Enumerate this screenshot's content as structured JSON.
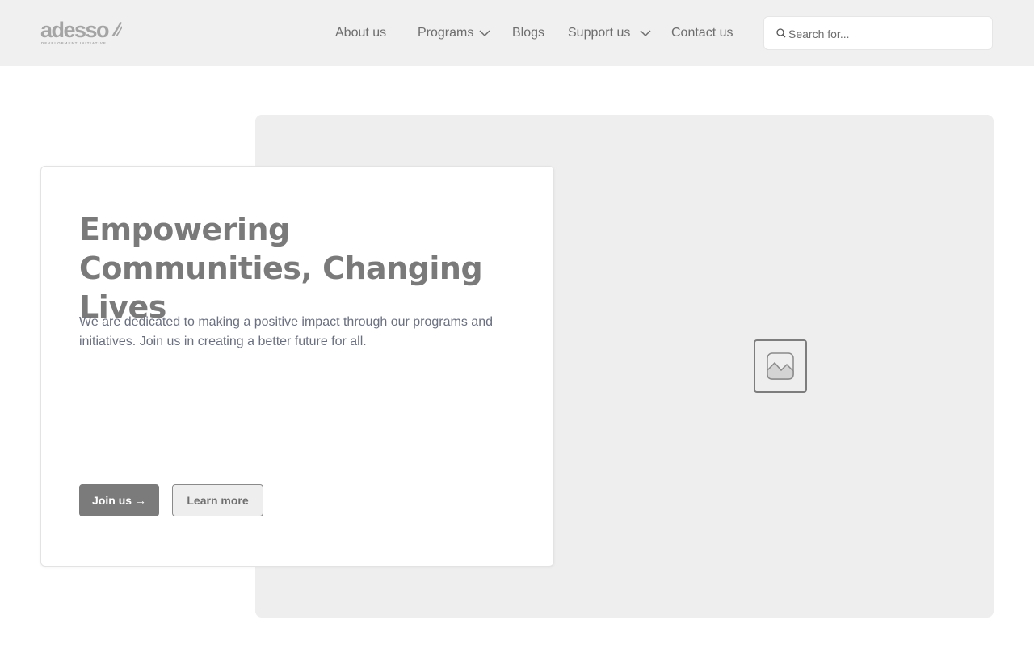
{
  "header": {
    "logo": {
      "word": "adesso",
      "tagline": "DEVELOPMENT INITIATIVE"
    },
    "nav": {
      "about": "About us",
      "programs": "Programs",
      "blogs": "Blogs",
      "support": "Support us",
      "contact": "Contact us"
    },
    "search": {
      "placeholder": "Search for...",
      "value": ""
    }
  },
  "hero": {
    "title": "Empowering Communities, Changing Lives",
    "description": "We are dedicated to making a positive impact through our programs and initiatives. Join us in creating a better future for all.",
    "primary_button": "Join us →",
    "secondary_button": "Learn more",
    "image_icon": "image-placeholder-icon"
  },
  "colors": {
    "header_bg": "#f0f0f0",
    "image_bg": "#eeeeee",
    "primary_button": "#7b7b7b",
    "description_text": "#6b7080"
  }
}
